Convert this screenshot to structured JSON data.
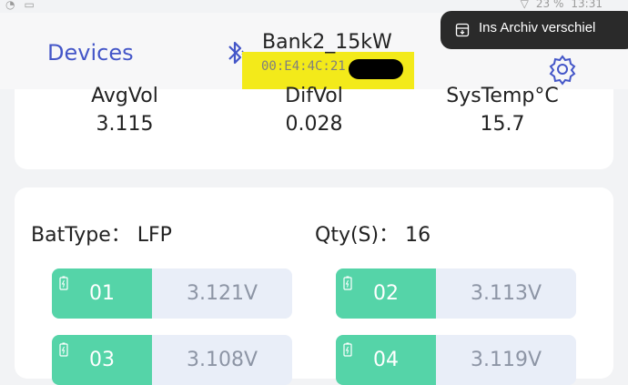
{
  "status_bar": {
    "battery": "23 %",
    "time": "13:31"
  },
  "header": {
    "back_label": "Devices",
    "device_name": "Bank2_15kW",
    "mac_visible": "00:E4:4C:21"
  },
  "toast": {
    "text": "Ins Archiv verschiel"
  },
  "summary": [
    {
      "label": "AvgVol",
      "value": "3.115"
    },
    {
      "label": "DifVol",
      "value": "0.028"
    },
    {
      "label": "SysTemp°C",
      "value": "15.7"
    }
  ],
  "pack": {
    "battype_text": "BatType： LFP",
    "qty_text": "Qty(S)： 16"
  },
  "cells": [
    {
      "id": "01",
      "voltage": "3.121V"
    },
    {
      "id": "02",
      "voltage": "3.113V"
    },
    {
      "id": "03",
      "voltage": "3.108V"
    },
    {
      "id": "04",
      "voltage": "3.119V"
    }
  ],
  "colors": {
    "accent": "#4456c8",
    "cell_green": "#55d4a8",
    "highlight": "#f3ea1a"
  }
}
